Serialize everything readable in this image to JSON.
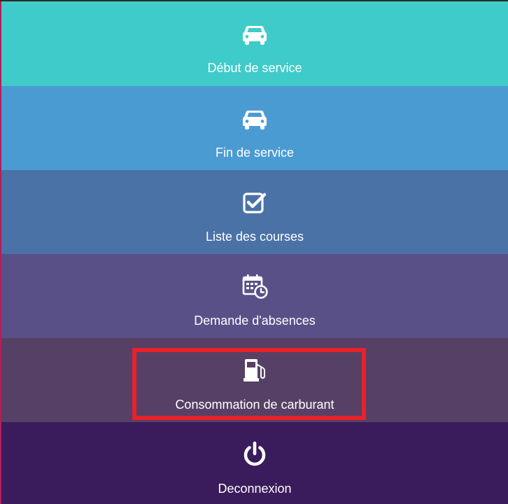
{
  "menu": {
    "items": [
      {
        "label": "Début de service",
        "icon": "car-icon"
      },
      {
        "label": "Fin de service",
        "icon": "car-icon"
      },
      {
        "label": "Liste des courses",
        "icon": "checkbox-icon"
      },
      {
        "label": "Demande d'absences",
        "icon": "calendar-clock-icon"
      },
      {
        "label": "Consommation de carburant",
        "icon": "fuel-pump-icon"
      },
      {
        "label": "Deconnexion",
        "icon": "power-icon"
      }
    ]
  },
  "colors": {
    "tile_1": "#3fcbc9",
    "tile_2": "#4b9bd3",
    "tile_3": "#4a72a6",
    "tile_4": "#5a5088",
    "tile_5": "#574065",
    "tile_6": "#3a1c5c",
    "highlight": "#e8212b"
  }
}
